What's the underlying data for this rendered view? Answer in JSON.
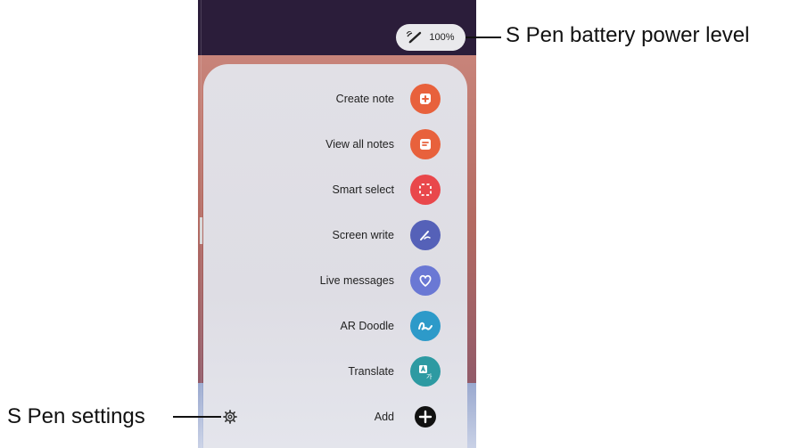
{
  "battery": {
    "level_text": "100%",
    "icon": "spen-icon"
  },
  "menu": {
    "items": [
      {
        "label": "Create note",
        "icon": "create-note-icon",
        "color": "#e8613c"
      },
      {
        "label": "View all notes",
        "icon": "view-notes-icon",
        "color": "#e8613c"
      },
      {
        "label": "Smart select",
        "icon": "smart-select-icon",
        "color": "#e9474b"
      },
      {
        "label": "Screen write",
        "icon": "screen-write-icon",
        "color": "#5561b8"
      },
      {
        "label": "Live messages",
        "icon": "live-messages-icon",
        "color": "#6a78d4"
      },
      {
        "label": "AR Doodle",
        "icon": "ar-doodle-icon",
        "color": "#2d9ac9"
      },
      {
        "label": "Translate",
        "icon": "translate-icon",
        "color": "#2d9aa2"
      },
      {
        "label": "Add",
        "icon": "add-icon",
        "color": "#111111"
      }
    ],
    "settings_icon": "gear-icon"
  },
  "callouts": {
    "battery_label": "S Pen battery power level",
    "settings_label": "S Pen settings"
  }
}
